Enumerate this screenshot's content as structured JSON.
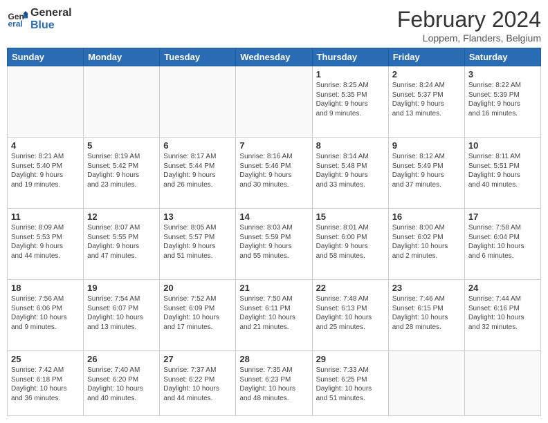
{
  "logo": {
    "line1": "General",
    "line2": "Blue"
  },
  "title": "February 2024",
  "subtitle": "Loppem, Flanders, Belgium",
  "days": [
    "Sunday",
    "Monday",
    "Tuesday",
    "Wednesday",
    "Thursday",
    "Friday",
    "Saturday"
  ],
  "weeks": [
    [
      {
        "num": "",
        "info": ""
      },
      {
        "num": "",
        "info": ""
      },
      {
        "num": "",
        "info": ""
      },
      {
        "num": "",
        "info": ""
      },
      {
        "num": "1",
        "info": "Sunrise: 8:25 AM\nSunset: 5:35 PM\nDaylight: 9 hours\nand 9 minutes."
      },
      {
        "num": "2",
        "info": "Sunrise: 8:24 AM\nSunset: 5:37 PM\nDaylight: 9 hours\nand 13 minutes."
      },
      {
        "num": "3",
        "info": "Sunrise: 8:22 AM\nSunset: 5:39 PM\nDaylight: 9 hours\nand 16 minutes."
      }
    ],
    [
      {
        "num": "4",
        "info": "Sunrise: 8:21 AM\nSunset: 5:40 PM\nDaylight: 9 hours\nand 19 minutes."
      },
      {
        "num": "5",
        "info": "Sunrise: 8:19 AM\nSunset: 5:42 PM\nDaylight: 9 hours\nand 23 minutes."
      },
      {
        "num": "6",
        "info": "Sunrise: 8:17 AM\nSunset: 5:44 PM\nDaylight: 9 hours\nand 26 minutes."
      },
      {
        "num": "7",
        "info": "Sunrise: 8:16 AM\nSunset: 5:46 PM\nDaylight: 9 hours\nand 30 minutes."
      },
      {
        "num": "8",
        "info": "Sunrise: 8:14 AM\nSunset: 5:48 PM\nDaylight: 9 hours\nand 33 minutes."
      },
      {
        "num": "9",
        "info": "Sunrise: 8:12 AM\nSunset: 5:49 PM\nDaylight: 9 hours\nand 37 minutes."
      },
      {
        "num": "10",
        "info": "Sunrise: 8:11 AM\nSunset: 5:51 PM\nDaylight: 9 hours\nand 40 minutes."
      }
    ],
    [
      {
        "num": "11",
        "info": "Sunrise: 8:09 AM\nSunset: 5:53 PM\nDaylight: 9 hours\nand 44 minutes."
      },
      {
        "num": "12",
        "info": "Sunrise: 8:07 AM\nSunset: 5:55 PM\nDaylight: 9 hours\nand 47 minutes."
      },
      {
        "num": "13",
        "info": "Sunrise: 8:05 AM\nSunset: 5:57 PM\nDaylight: 9 hours\nand 51 minutes."
      },
      {
        "num": "14",
        "info": "Sunrise: 8:03 AM\nSunset: 5:59 PM\nDaylight: 9 hours\nand 55 minutes."
      },
      {
        "num": "15",
        "info": "Sunrise: 8:01 AM\nSunset: 6:00 PM\nDaylight: 9 hours\nand 58 minutes."
      },
      {
        "num": "16",
        "info": "Sunrise: 8:00 AM\nSunset: 6:02 PM\nDaylight: 10 hours\nand 2 minutes."
      },
      {
        "num": "17",
        "info": "Sunrise: 7:58 AM\nSunset: 6:04 PM\nDaylight: 10 hours\nand 6 minutes."
      }
    ],
    [
      {
        "num": "18",
        "info": "Sunrise: 7:56 AM\nSunset: 6:06 PM\nDaylight: 10 hours\nand 9 minutes."
      },
      {
        "num": "19",
        "info": "Sunrise: 7:54 AM\nSunset: 6:07 PM\nDaylight: 10 hours\nand 13 minutes."
      },
      {
        "num": "20",
        "info": "Sunrise: 7:52 AM\nSunset: 6:09 PM\nDaylight: 10 hours\nand 17 minutes."
      },
      {
        "num": "21",
        "info": "Sunrise: 7:50 AM\nSunset: 6:11 PM\nDaylight: 10 hours\nand 21 minutes."
      },
      {
        "num": "22",
        "info": "Sunrise: 7:48 AM\nSunset: 6:13 PM\nDaylight: 10 hours\nand 25 minutes."
      },
      {
        "num": "23",
        "info": "Sunrise: 7:46 AM\nSunset: 6:15 PM\nDaylight: 10 hours\nand 28 minutes."
      },
      {
        "num": "24",
        "info": "Sunrise: 7:44 AM\nSunset: 6:16 PM\nDaylight: 10 hours\nand 32 minutes."
      }
    ],
    [
      {
        "num": "25",
        "info": "Sunrise: 7:42 AM\nSunset: 6:18 PM\nDaylight: 10 hours\nand 36 minutes."
      },
      {
        "num": "26",
        "info": "Sunrise: 7:40 AM\nSunset: 6:20 PM\nDaylight: 10 hours\nand 40 minutes."
      },
      {
        "num": "27",
        "info": "Sunrise: 7:37 AM\nSunset: 6:22 PM\nDaylight: 10 hours\nand 44 minutes."
      },
      {
        "num": "28",
        "info": "Sunrise: 7:35 AM\nSunset: 6:23 PM\nDaylight: 10 hours\nand 48 minutes."
      },
      {
        "num": "29",
        "info": "Sunrise: 7:33 AM\nSunset: 6:25 PM\nDaylight: 10 hours\nand 51 minutes."
      },
      {
        "num": "",
        "info": ""
      },
      {
        "num": "",
        "info": ""
      }
    ]
  ]
}
